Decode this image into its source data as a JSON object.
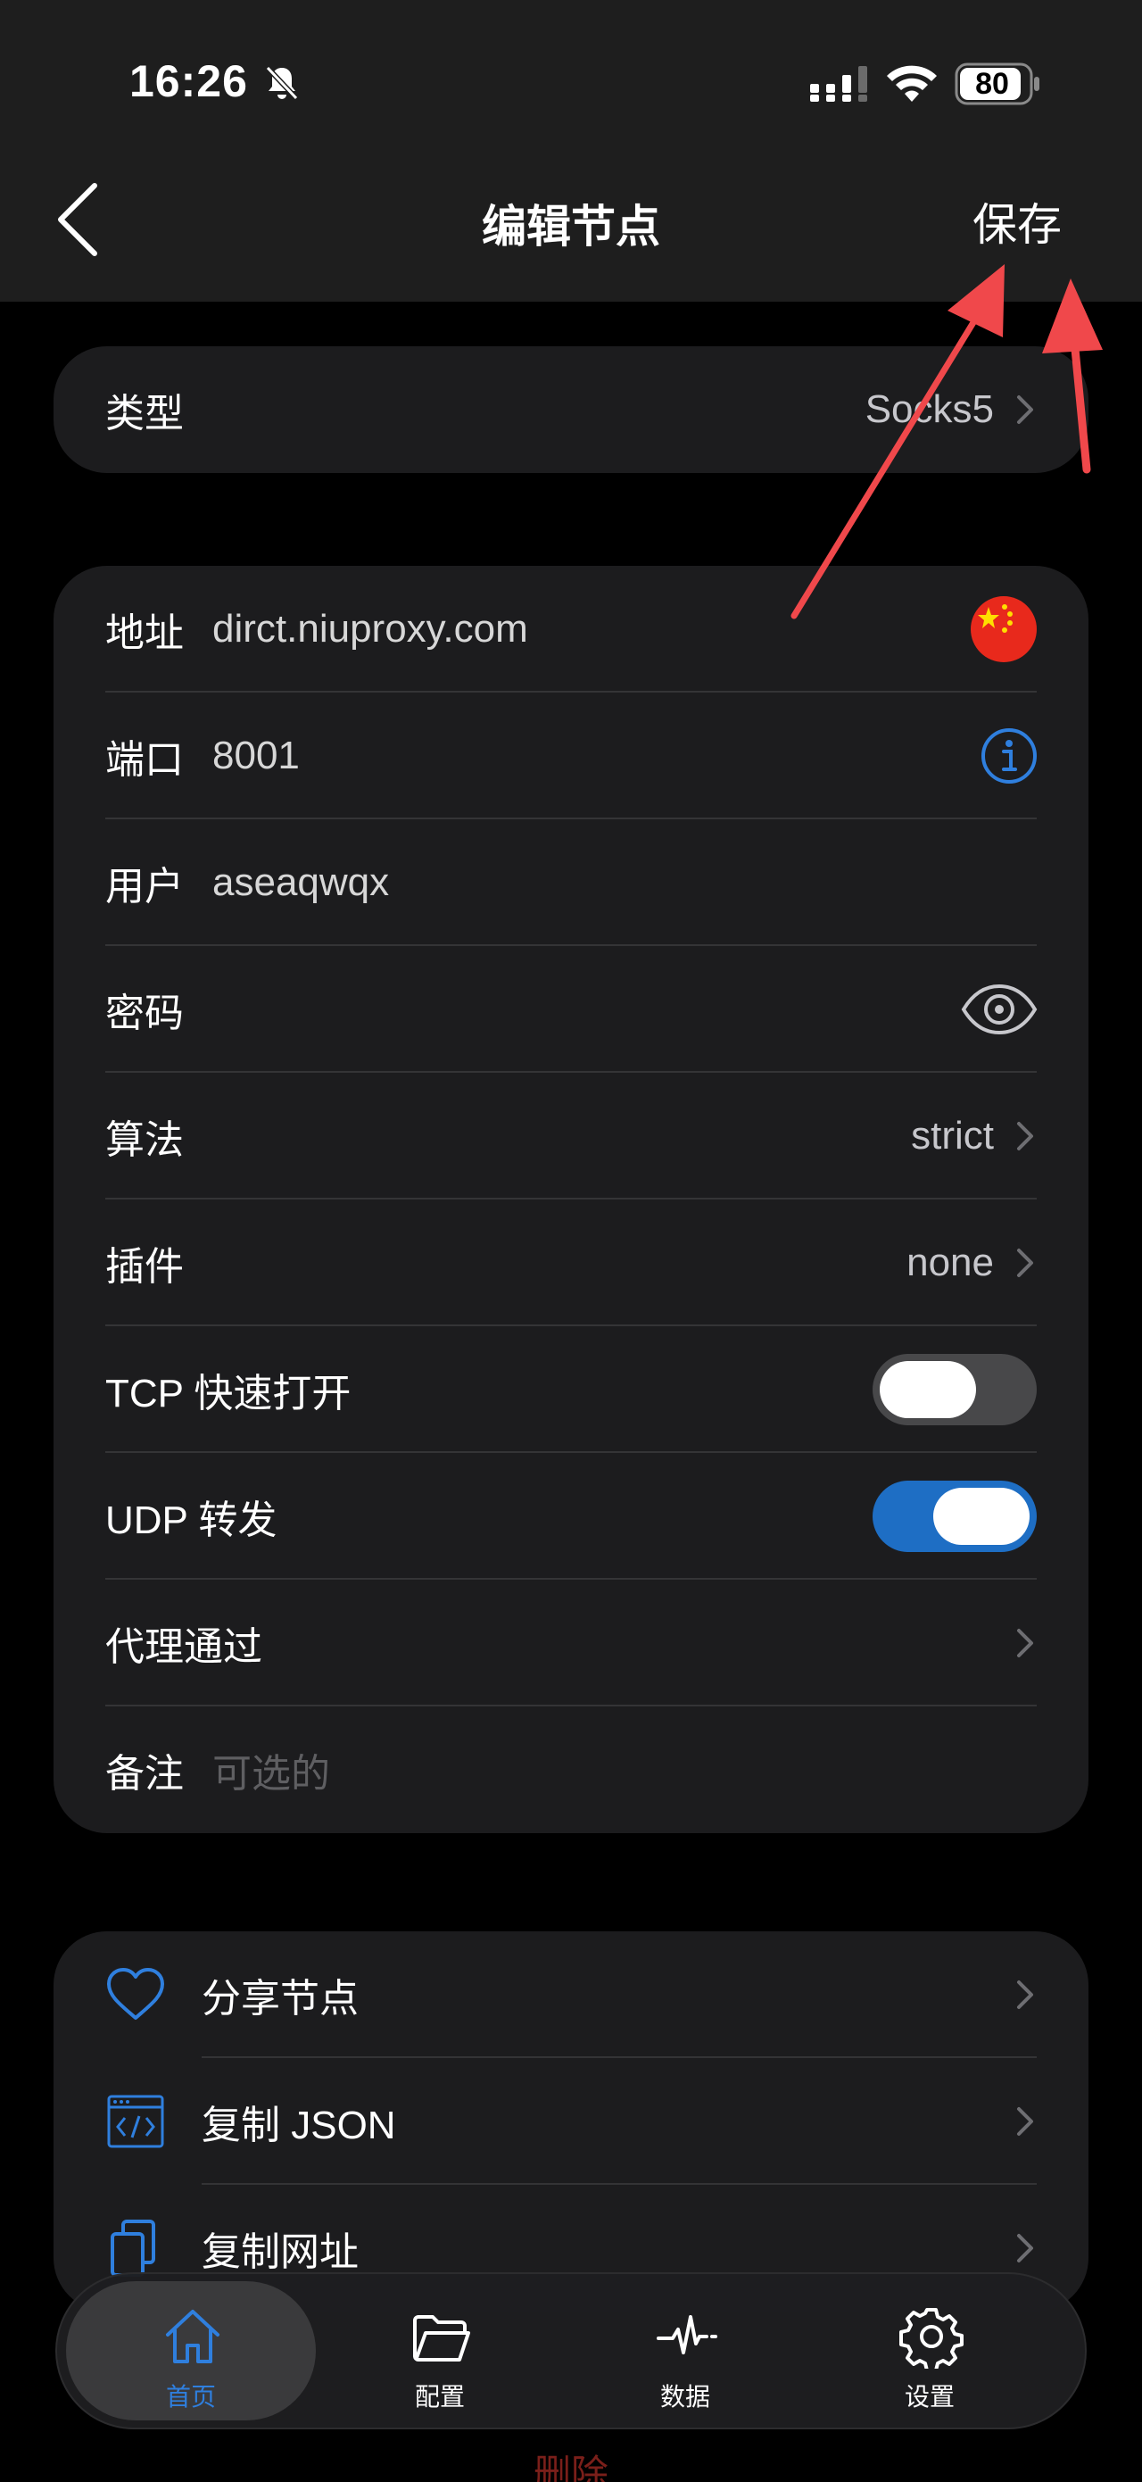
{
  "status": {
    "time": "16:26",
    "battery": "80"
  },
  "nav": {
    "title": "编辑节点",
    "save": "保存"
  },
  "type_row": {
    "label": "类型",
    "value": "Socks5"
  },
  "form": {
    "address": {
      "label": "地址",
      "value": "dirct.niuproxy.com"
    },
    "port": {
      "label": "端口",
      "value": "8001"
    },
    "user": {
      "label": "用户",
      "value": "aseaqwqx"
    },
    "password": {
      "label": "密码"
    },
    "algorithm": {
      "label": "算法",
      "value": "strict"
    },
    "plugin": {
      "label": "插件",
      "value": "none"
    },
    "tcp_fast_open": {
      "label": "TCP 快速打开",
      "on": false
    },
    "udp_relay": {
      "label": "UDP 转发",
      "on": true
    },
    "proxy_via": {
      "label": "代理通过"
    },
    "note": {
      "label": "备注",
      "placeholder": "可选的"
    }
  },
  "actions": [
    {
      "label": "分享节点",
      "icon": "heart-icon"
    },
    {
      "label": "复制 JSON",
      "icon": "code-icon"
    },
    {
      "label": "复制网址",
      "icon": "copy-icon"
    }
  ],
  "delete_label": "删除",
  "tabs": [
    {
      "label": "首页",
      "icon": "home-icon",
      "active": true
    },
    {
      "label": "配置",
      "icon": "folder-icon",
      "active": false
    },
    {
      "label": "数据",
      "icon": "pulse-icon",
      "active": false
    },
    {
      "label": "设置",
      "icon": "gear-icon",
      "active": false
    }
  ],
  "colors": {
    "accent": "#2f7fde",
    "toggle_on": "#1e6ec4",
    "annotation": "#f0484b",
    "card": "#1c1c1e"
  }
}
